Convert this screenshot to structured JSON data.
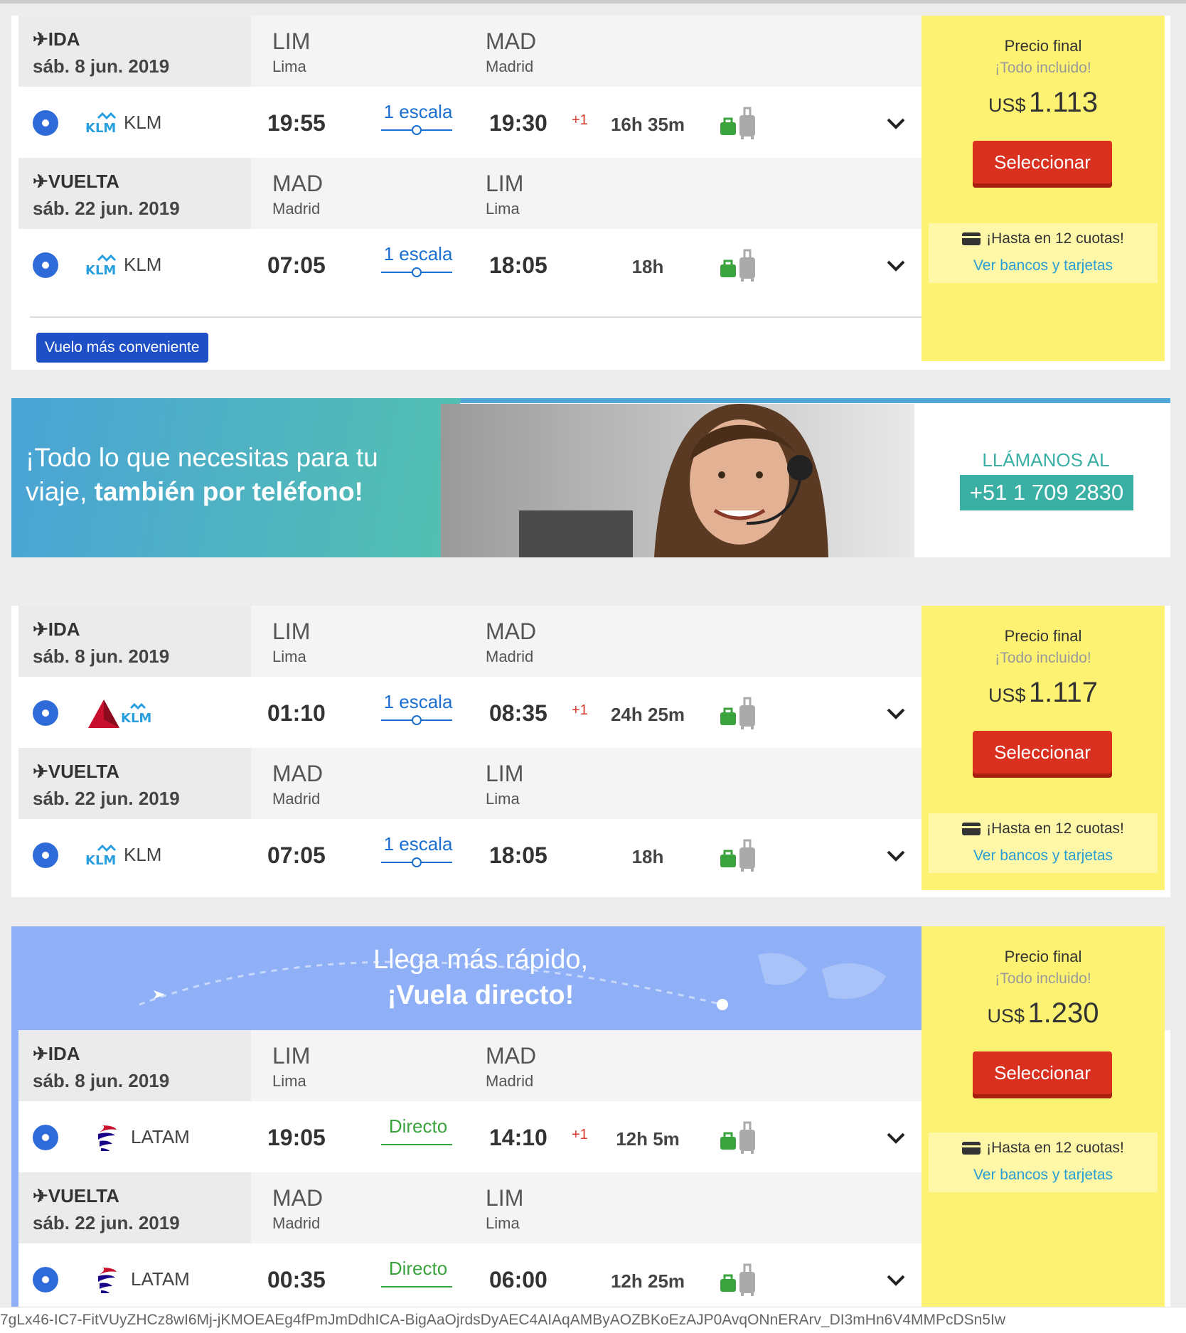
{
  "offers": [
    {
      "legs": [
        {
          "dir": "✈IDA",
          "date": "sáb. 8 jun. 2019",
          "from_code": "LIM",
          "from_city": "Lima",
          "to_code": "MAD",
          "to_city": "Madrid",
          "airline": "KLM",
          "dep": "19:55",
          "stops": "1 escala",
          "arr": "19:30",
          "plus": "+1",
          "dur": "16h 35m"
        },
        {
          "dir": "✈VUELTA",
          "date": "sáb. 22 jun. 2019",
          "from_code": "MAD",
          "from_city": "Madrid",
          "to_code": "LIM",
          "to_city": "Lima",
          "airline": "KLM",
          "dep": "07:05",
          "stops": "1 escala",
          "arr": "18:05",
          "plus": "",
          "dur": "18h"
        }
      ],
      "badge": "Vuelo más conveniente",
      "price": {
        "label": "Precio final",
        "sub": "¡Todo incluido!",
        "currency": "US$",
        "amount": "1.113",
        "button": "Seleccionar",
        "cuotas": "¡Hasta en 12 cuotas!",
        "link": "Ver bancos y tarjetas"
      }
    },
    {
      "legs": [
        {
          "dir": "✈IDA",
          "date": "sáb. 8 jun. 2019",
          "from_code": "LIM",
          "from_city": "Lima",
          "to_code": "MAD",
          "to_city": "Madrid",
          "airline": "",
          "dep": "01:10",
          "stops": "1 escala",
          "arr": "08:35",
          "plus": "+1",
          "dur": "24h 25m"
        },
        {
          "dir": "✈VUELTA",
          "date": "sáb. 22 jun. 2019",
          "from_code": "MAD",
          "from_city": "Madrid",
          "to_code": "LIM",
          "to_city": "Lima",
          "airline": "KLM",
          "dep": "07:05",
          "stops": "1 escala",
          "arr": "18:05",
          "plus": "",
          "dur": "18h"
        }
      ],
      "price": {
        "label": "Precio final",
        "sub": "¡Todo incluido!",
        "currency": "US$",
        "amount": "1.117",
        "button": "Seleccionar",
        "cuotas": "¡Hasta en 12 cuotas!",
        "link": "Ver bancos y tarjetas"
      }
    },
    {
      "banner_line1": "Llega más rápido,",
      "banner_line2": "¡Vuela directo!",
      "legs": [
        {
          "dir": "✈IDA",
          "date": "sáb. 8 jun. 2019",
          "from_code": "LIM",
          "from_city": "Lima",
          "to_code": "MAD",
          "to_city": "Madrid",
          "airline": "LATAM",
          "dep": "19:05",
          "stops": "Directo",
          "arr": "14:10",
          "plus": "+1",
          "dur": "12h 5m"
        },
        {
          "dir": "✈VUELTA",
          "date": "sáb. 22 jun. 2019",
          "from_code": "MAD",
          "from_city": "Madrid",
          "to_code": "LIM",
          "to_city": "Lima",
          "airline": "LATAM",
          "dep": "00:35",
          "stops": "Directo",
          "arr": "06:00",
          "plus": "",
          "dur": "12h 25m"
        }
      ],
      "price": {
        "label": "Precio final",
        "sub": "¡Todo incluido!",
        "currency": "US$",
        "amount": "1.230",
        "button": "Seleccionar",
        "cuotas": "¡Hasta en 12 cuotas!",
        "link": "Ver bancos y tarjetas"
      }
    }
  ],
  "phone_banner": {
    "text_a": "¡Todo lo que necesitas para tu viaje, ",
    "text_b": "también por teléfono!",
    "call_label": "LLÁMANOS AL",
    "phone": "+51 1 709 2830"
  },
  "footer_url": "7gLx46-IC7-FitVUyZHCz8wI6Mj-jKMOEAEg4fPmJmDdhICA-BigAaOjrdsDyAEC4AIAqAMByAOZBKoEzAJP0AvqONnERArv_DI3mHn6V4MMPcDSn5Iw",
  "colors": {
    "accent": "#2f6bd8",
    "price_bg": "#fef273",
    "select": "#d9301f",
    "phone": "#3ab0a5"
  }
}
